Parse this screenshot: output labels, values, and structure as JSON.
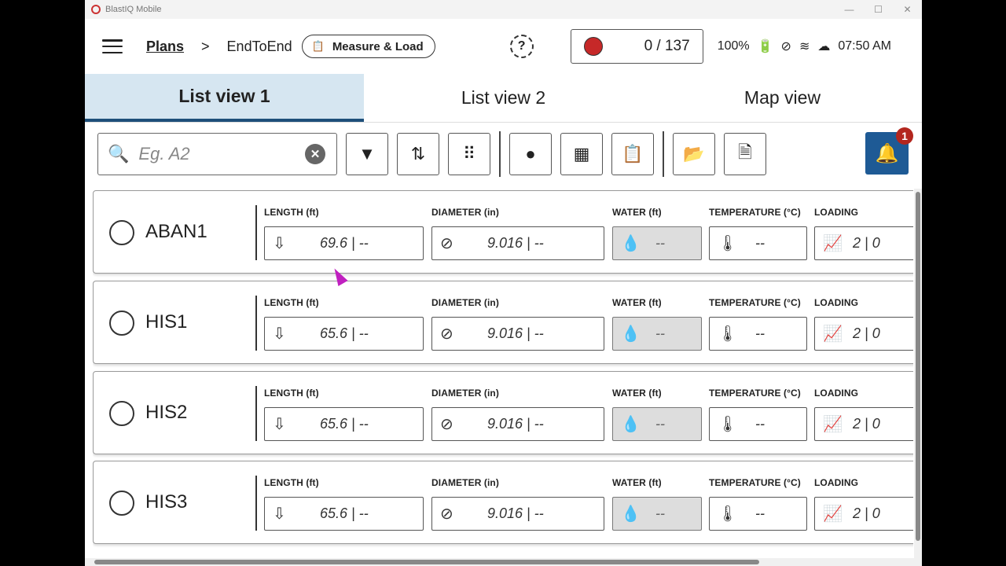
{
  "window": {
    "title": "BlastIQ Mobile",
    "controls": [
      "—",
      "☐",
      "✕"
    ]
  },
  "header": {
    "breadcrumb_root": "Plans",
    "breadcrumb_sep": ">",
    "breadcrumb_current": "EndToEnd",
    "mode_label": "Measure & Load",
    "mode_icon": "clipboard-icon",
    "counter": "0 / 137",
    "battery": "100%",
    "time": "07:50 AM"
  },
  "tabs": [
    "List view 1",
    "List view 2",
    "Map view"
  ],
  "active_tab": "List view 1",
  "toolbar": {
    "search_placeholder": "Eg. A2",
    "search_value": "",
    "notification_count": "1"
  },
  "columns": {
    "length": "LENGTH (ft)",
    "diameter": "DIAMETER (in)",
    "water": "WATER (ft)",
    "temperature": "TEMPERATURE (°C)",
    "loading": "LOADING"
  },
  "rows": [
    {
      "name": "ABAN1",
      "length": "69.6 | --",
      "diameter": "9.016 | --",
      "water": "--",
      "temperature": "--",
      "loading": "2 | 0"
    },
    {
      "name": "HIS1",
      "length": "65.6 | --",
      "diameter": "9.016 | --",
      "water": "--",
      "temperature": "--",
      "loading": "2 | 0"
    },
    {
      "name": "HIS2",
      "length": "65.6 | --",
      "diameter": "9.016 | --",
      "water": "--",
      "temperature": "--",
      "loading": "2 | 0"
    },
    {
      "name": "HIS3",
      "length": "65.6 | --",
      "diameter": "9.016 | --",
      "water": "--",
      "temperature": "--",
      "loading": "2 | 0"
    }
  ],
  "colors": {
    "accent": "#1e5a95",
    "active_tab_bg": "#d6e6f1",
    "record_dot": "#c62828",
    "badge": "#b3261e"
  }
}
